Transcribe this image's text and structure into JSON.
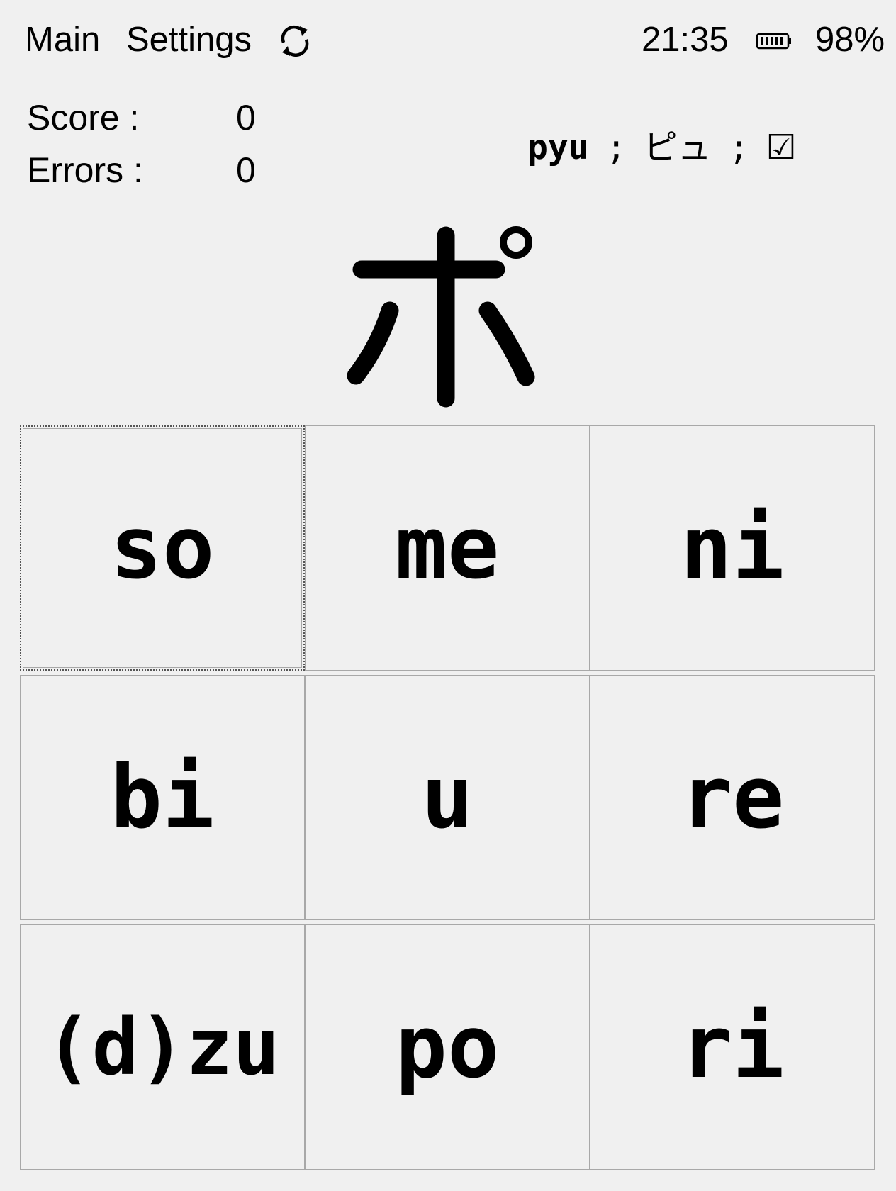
{
  "topbar": {
    "main_label": "Main",
    "settings_label": "Settings",
    "time": "21:35",
    "battery_percent": "98%",
    "battery_level": 0.98
  },
  "stats": {
    "score_label": "Score :",
    "score_value": "0",
    "errors_label": "Errors :",
    "errors_value": "0"
  },
  "last_answer": {
    "romaji": "pyu",
    "separator": ";",
    "kana": "ピュ",
    "result": "☑"
  },
  "question": {
    "kana": "ポ"
  },
  "answers": [
    "so",
    "me",
    "ni",
    "bi",
    "u",
    "re",
    "(d)zu",
    "po",
    "ri"
  ]
}
